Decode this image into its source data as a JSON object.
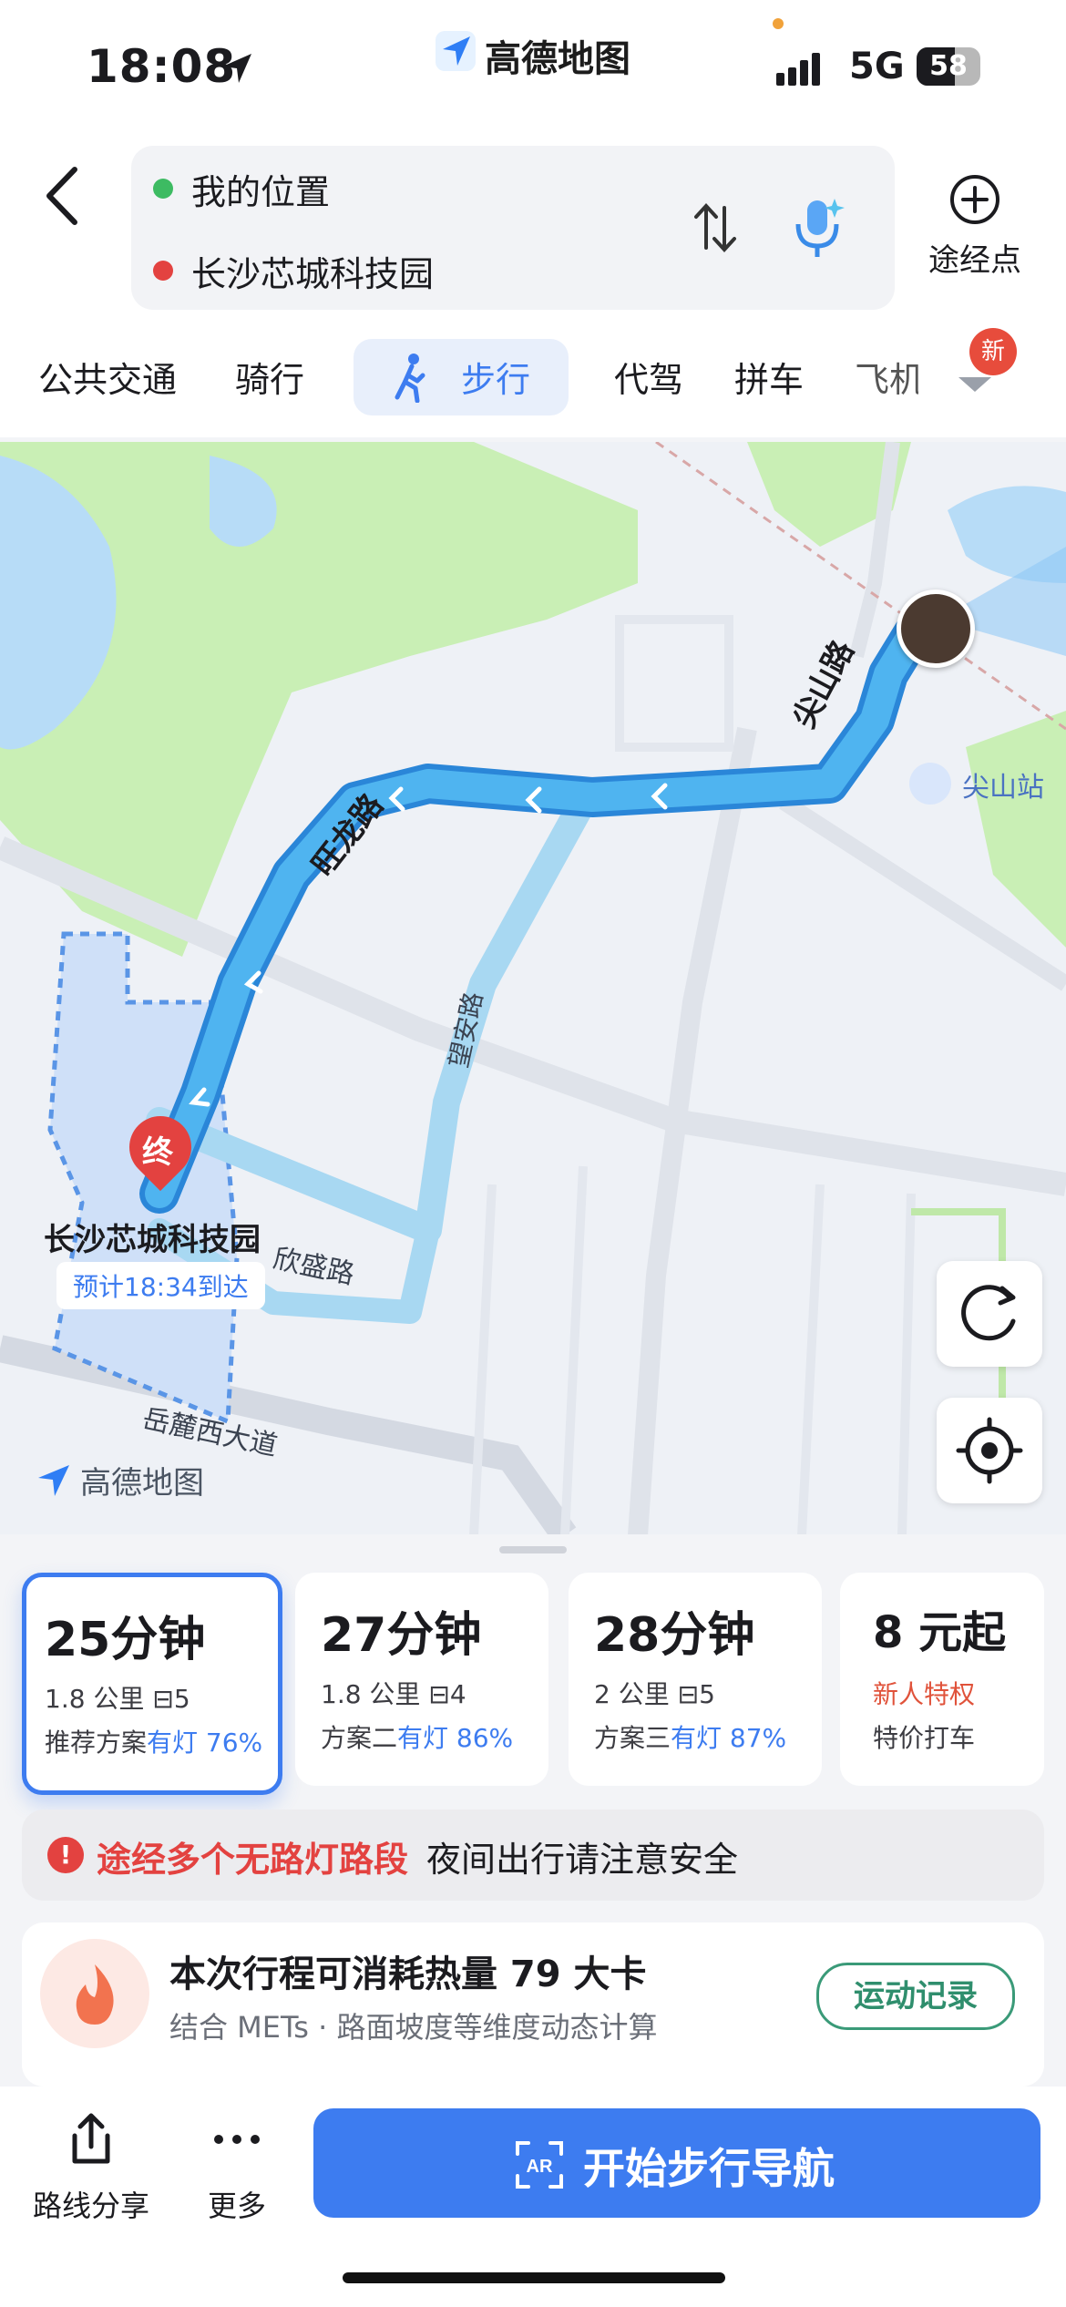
{
  "status_bar": {
    "time": "18:08",
    "app_logo": "高德地图",
    "network": "5G",
    "battery": "58"
  },
  "route": {
    "from": "我的位置",
    "to": "长沙芯城科技园",
    "waypoint_label": "途经点"
  },
  "tabs": [
    {
      "label": "公共交通"
    },
    {
      "label": "骑行"
    },
    {
      "label": "步行",
      "active": true
    },
    {
      "label": "代驾"
    },
    {
      "label": "拼车"
    },
    {
      "label": "飞机"
    }
  ],
  "tabs_badge": "新",
  "map": {
    "road_labels": [
      "旺龙路",
      "尖山路",
      "望安路",
      "欣盛路",
      "岳麓西大道"
    ],
    "station": "尖山站",
    "end_marker": "终",
    "destination_name": "长沙芯城科技园",
    "eta": "预计18:34到达",
    "logo": "高德地图"
  },
  "plans": [
    {
      "time": "25分钟",
      "dist": "1.8 公里",
      "lights": "5",
      "label": "推荐方案",
      "lit_text": "有灯 76%",
      "selected": true
    },
    {
      "time": "27分钟",
      "dist": "1.8 公里",
      "lights": "4",
      "label": "方案二",
      "lit_text": "有灯 86%"
    },
    {
      "time": "28分钟",
      "dist": "2 公里",
      "lights": "5",
      "label": "方案三",
      "lit_text": "有灯 87%"
    },
    {
      "time": "8 元起",
      "promo": "新人特权",
      "sub": "特价打车"
    }
  ],
  "warning": {
    "red": "途经多个无路灯路段",
    "text": "夜间出行请注意安全"
  },
  "calorie": {
    "title": "本次行程可消耗热量 79 大卡",
    "sub": "结合 METs · 路面坡度等维度动态计算",
    "button": "运动记录"
  },
  "bottom": {
    "share": "路线分享",
    "more": "更多",
    "start": "开始步行导航"
  },
  "colors": {
    "accent": "#3d7cf0",
    "route": "#3aa8ea",
    "alt_route": "#a8d8f2",
    "green_area": "#c9efb5",
    "water": "#b7dcf7",
    "warning": "#e34240"
  }
}
